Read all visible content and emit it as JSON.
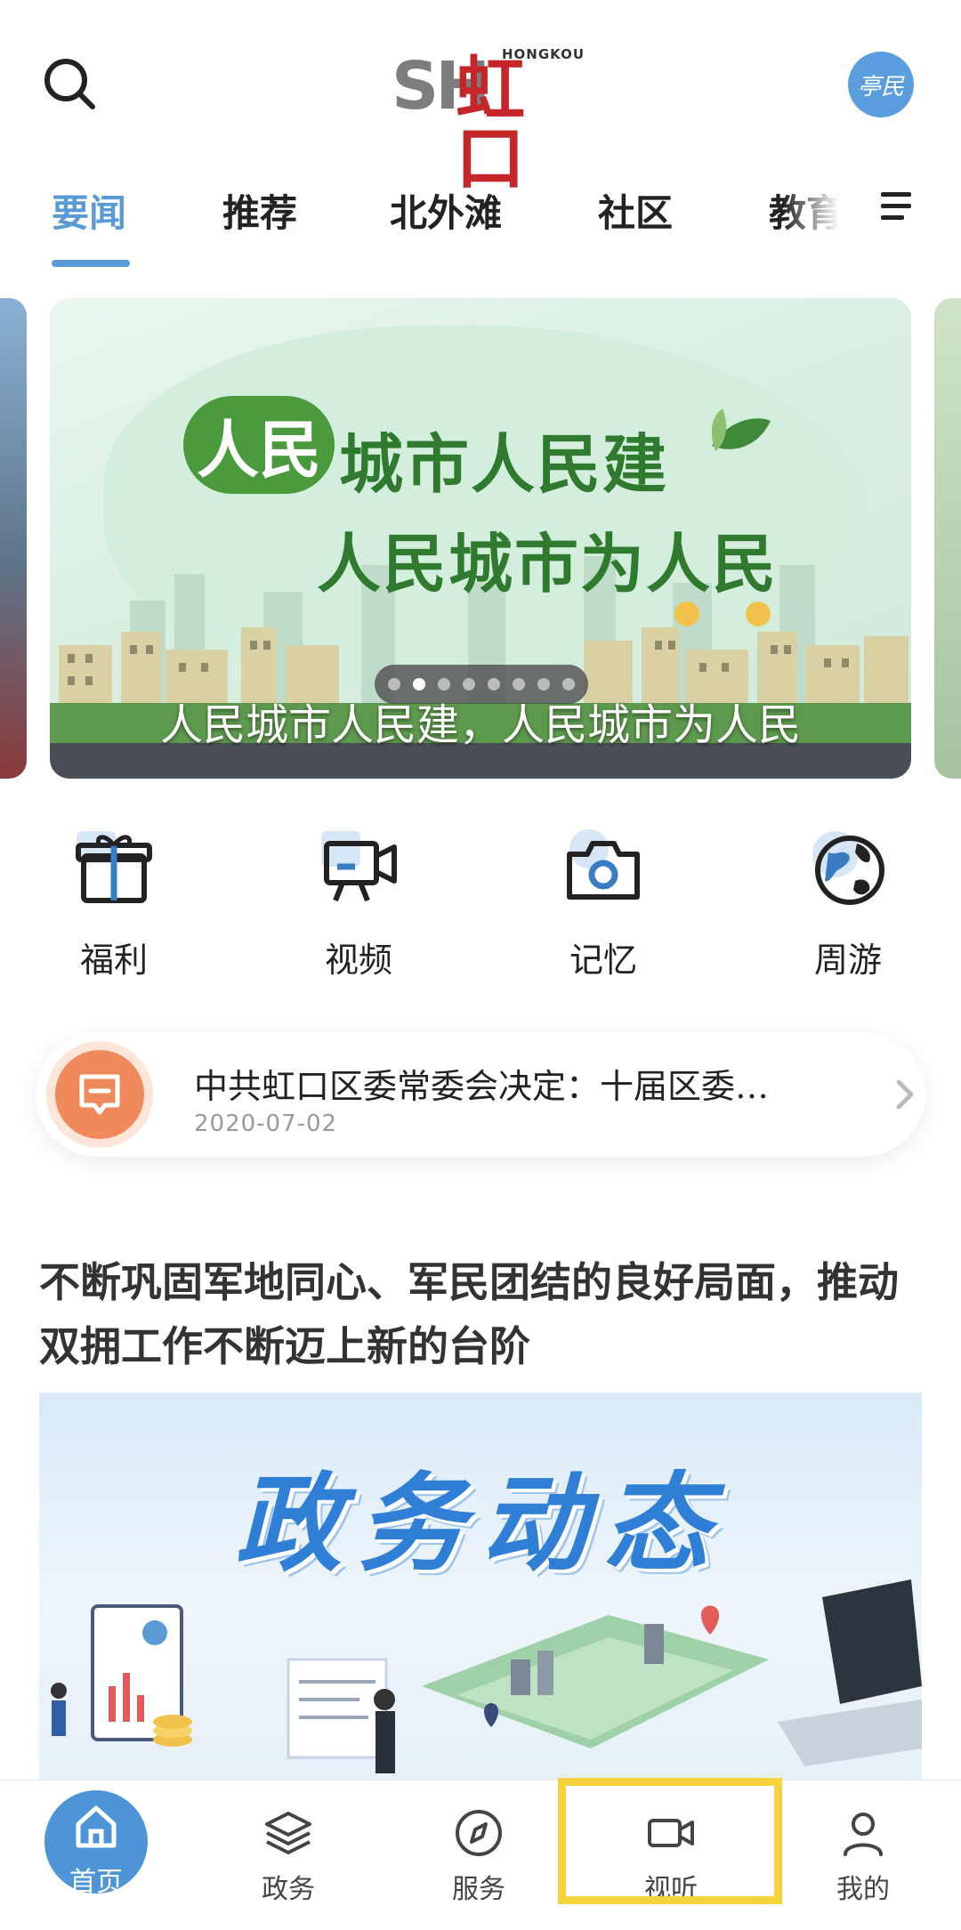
{
  "header": {
    "logo": {
      "mark": "SH",
      "name": "虹口",
      "en": "HONGKOU"
    },
    "avatar_text": "亭民"
  },
  "tabs": [
    {
      "label": "要闻",
      "active": true
    },
    {
      "label": "推荐",
      "active": false
    },
    {
      "label": "北外滩",
      "active": false
    },
    {
      "label": "社区",
      "active": false
    },
    {
      "label": "教育",
      "active": false
    }
  ],
  "banner": {
    "badge": "人民",
    "line1": "城市人民建",
    "line2": "人民城市为人民",
    "caption": "人民城市人民建，人民城市为人民",
    "slide_count": 8,
    "active_slide": 2
  },
  "quick_links": [
    {
      "label": "福利",
      "icon": "gift-icon"
    },
    {
      "label": "视频",
      "icon": "video-camera-icon"
    },
    {
      "label": "记忆",
      "icon": "camera-icon"
    },
    {
      "label": "周游",
      "icon": "globe-icon"
    }
  ],
  "notice": {
    "title": "中共虹口区委常委会决定：十届区委…",
    "date": "2020-07-02"
  },
  "article": {
    "title": "不断巩固军地同心、军民团结的良好局面，推动双拥工作不断迈上新的台阶",
    "image_title": "政务动态"
  },
  "bottom_nav": [
    {
      "label": "首页",
      "icon": "home-icon",
      "active": true
    },
    {
      "label": "政务",
      "icon": "layers-icon",
      "active": false
    },
    {
      "label": "服务",
      "icon": "compass-icon",
      "active": false
    },
    {
      "label": "视听",
      "icon": "video-icon",
      "active": false,
      "highlighted": true
    },
    {
      "label": "我的",
      "icon": "user-icon",
      "active": false
    }
  ],
  "colors": {
    "accent": "#5b9bd5",
    "brand_red": "#c4262a",
    "nav_home": "#4e95d8",
    "highlight": "#f6d23c",
    "notice_icon": "#f08a5d"
  }
}
